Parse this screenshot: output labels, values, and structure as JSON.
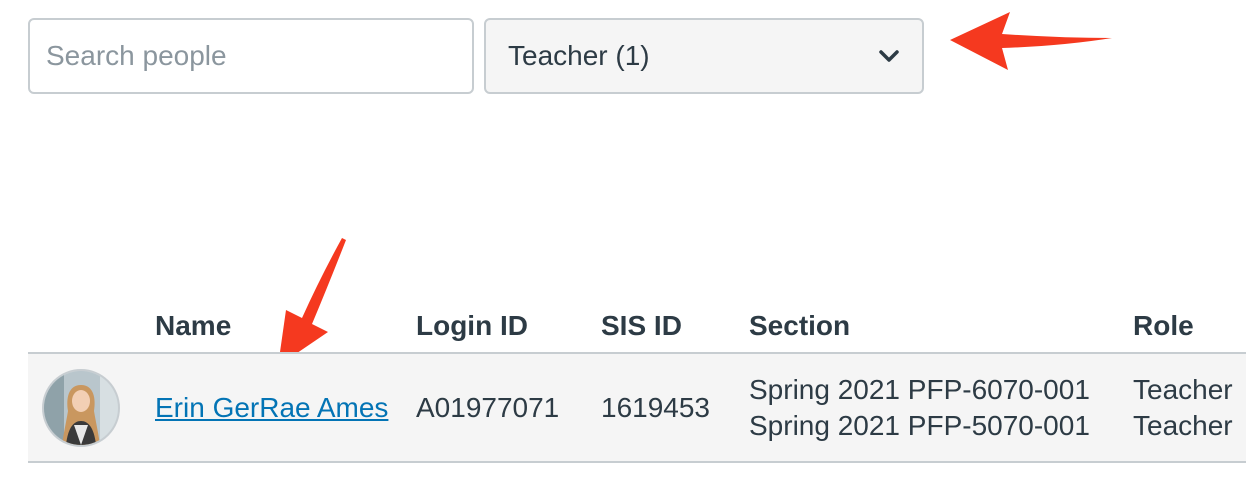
{
  "search": {
    "placeholder": "Search people"
  },
  "role_filter": {
    "selected": "Teacher (1)"
  },
  "table": {
    "headers": {
      "name": "Name",
      "login_id": "Login ID",
      "sis_id": "SIS ID",
      "section": "Section",
      "role": "Role"
    },
    "rows": [
      {
        "name": "Erin GerRae Ames",
        "login_id": "A01977071",
        "sis_id": "1619453",
        "sections": [
          "Spring 2021 PFP-6070-001",
          "Spring 2021 PFP-5070-001"
        ],
        "roles": [
          "Teacher",
          "Teacher"
        ]
      }
    ]
  },
  "colors": {
    "link": "#0374b5",
    "annotation_arrow": "#f5391f",
    "row_bg": "#f5f5f5",
    "border": "#c7cdd1"
  }
}
